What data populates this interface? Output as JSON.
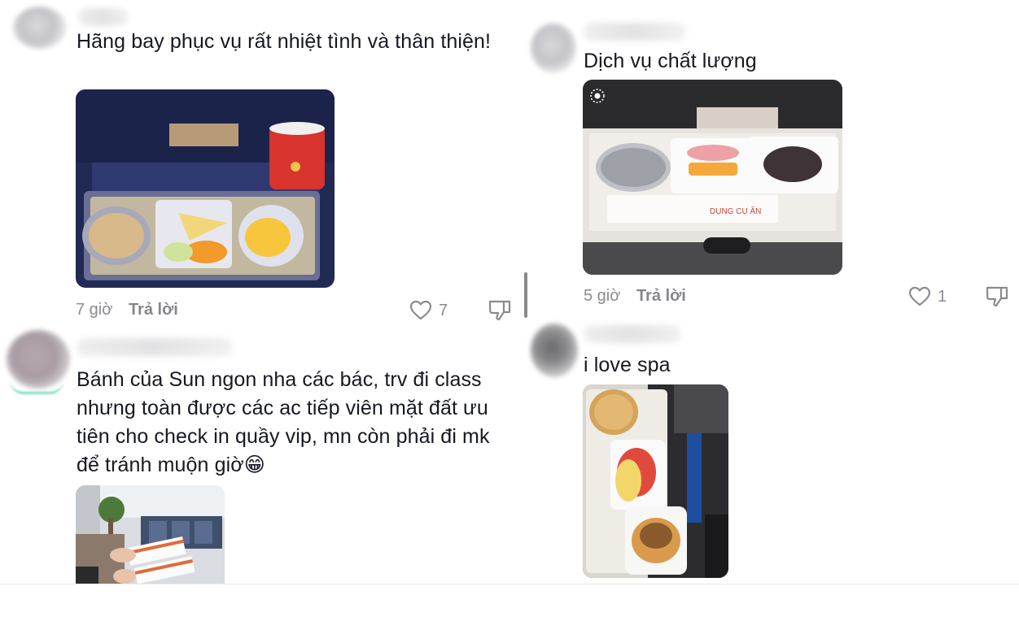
{
  "comments": [
    {
      "text": "Hãng bay phục vụ rất nhiệt tình và thân thiện!",
      "time": "7 giờ",
      "reply_label": "Trả lời",
      "likes": "7",
      "photo": "airline meal tray with nuts, fruit and pudding"
    },
    {
      "text": "Bánh của Sun ngon nha các bác, trv đi class nhưng toàn được các ac tiếp viên mặt đất ưu tiên cho check in quầy vip, mn còn phải đi mk để tránh muộn giờ😁",
      "photo": "hands holding boarding passes in airport lounge"
    },
    {
      "text": "Dịch vụ chất lượng",
      "time": "5 giờ",
      "reply_label": "Trả lời",
      "likes": "1",
      "photo": "airline meal tray with foil dish, fruit box and cake",
      "photo_caption": "DỤNG CỤ ĂN"
    },
    {
      "text": "i love spa",
      "photo": "airline snack tray with bread, fruit and pastry"
    }
  ],
  "icons": {
    "like": "heart-outline-icon",
    "dislike": "thumbs-down-outline-icon",
    "live_photo": "live-photo-icon"
  },
  "colors": {
    "text": "#161823",
    "meta": "#8a8b91",
    "background": "#ffffff"
  }
}
